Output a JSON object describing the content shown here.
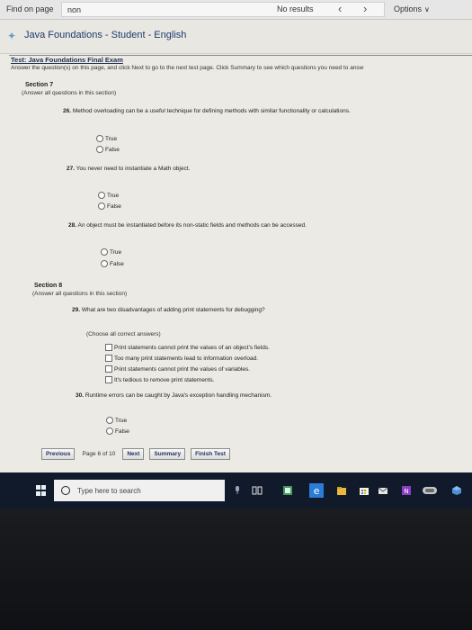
{
  "findbar": {
    "label": "Find on page",
    "query": "non",
    "results": "No results",
    "prev_glyph": "‹",
    "next_glyph": "›",
    "options": "Options"
  },
  "app": {
    "title": "Java Foundations - Student - English"
  },
  "test": {
    "name": "Test: Java Foundations Final Exam",
    "instructions": "Answer the question(s) on this page, and click Next to go to the next test page. Click Summary to see which questions you need to answ"
  },
  "sections": [
    {
      "title": "Section 7",
      "subtitle": "(Answer all questions in this section)"
    },
    {
      "title": "Section 8",
      "subtitle": "(Answer all questions in this section)"
    }
  ],
  "questions": [
    {
      "number": "26.",
      "text": "Method overloading can be a useful technique for defining methods with similar functionality or calculations.",
      "options": [
        "True",
        "False"
      ]
    },
    {
      "number": "27.",
      "text": "You never need to instantiate a Math object.",
      "options": [
        "True",
        "False"
      ]
    },
    {
      "number": "28.",
      "text": "An object must be instantiated before its non-static fields and methods can be accessed.",
      "options": [
        "True",
        "False"
      ]
    },
    {
      "number": "29.",
      "text": "What are two disadvantages of adding print statements for debugging?",
      "note": "(Choose all correct answers)",
      "options": [
        "Print statements cannot print the values of an object's fields.",
        "Too many print statements lead to information overload.",
        "Print statements cannot print the values of variables.",
        "It's tedious to remove print statements."
      ]
    },
    {
      "number": "30.",
      "text": "Runtime errors can be caught by Java's exception handling mechanism.",
      "options": [
        "True",
        "False"
      ]
    }
  ],
  "nav": {
    "previous": "Previous",
    "page_info": "Page 6 of 10",
    "next": "Next",
    "summary": "Summary",
    "finish": "Finish Test"
  },
  "taskbar": {
    "search_placeholder": "Type here to search"
  },
  "colors": {
    "accent": "#1f2f5f",
    "taskbar": "#101a2a",
    "edge_blue": "#2b7cd6"
  }
}
